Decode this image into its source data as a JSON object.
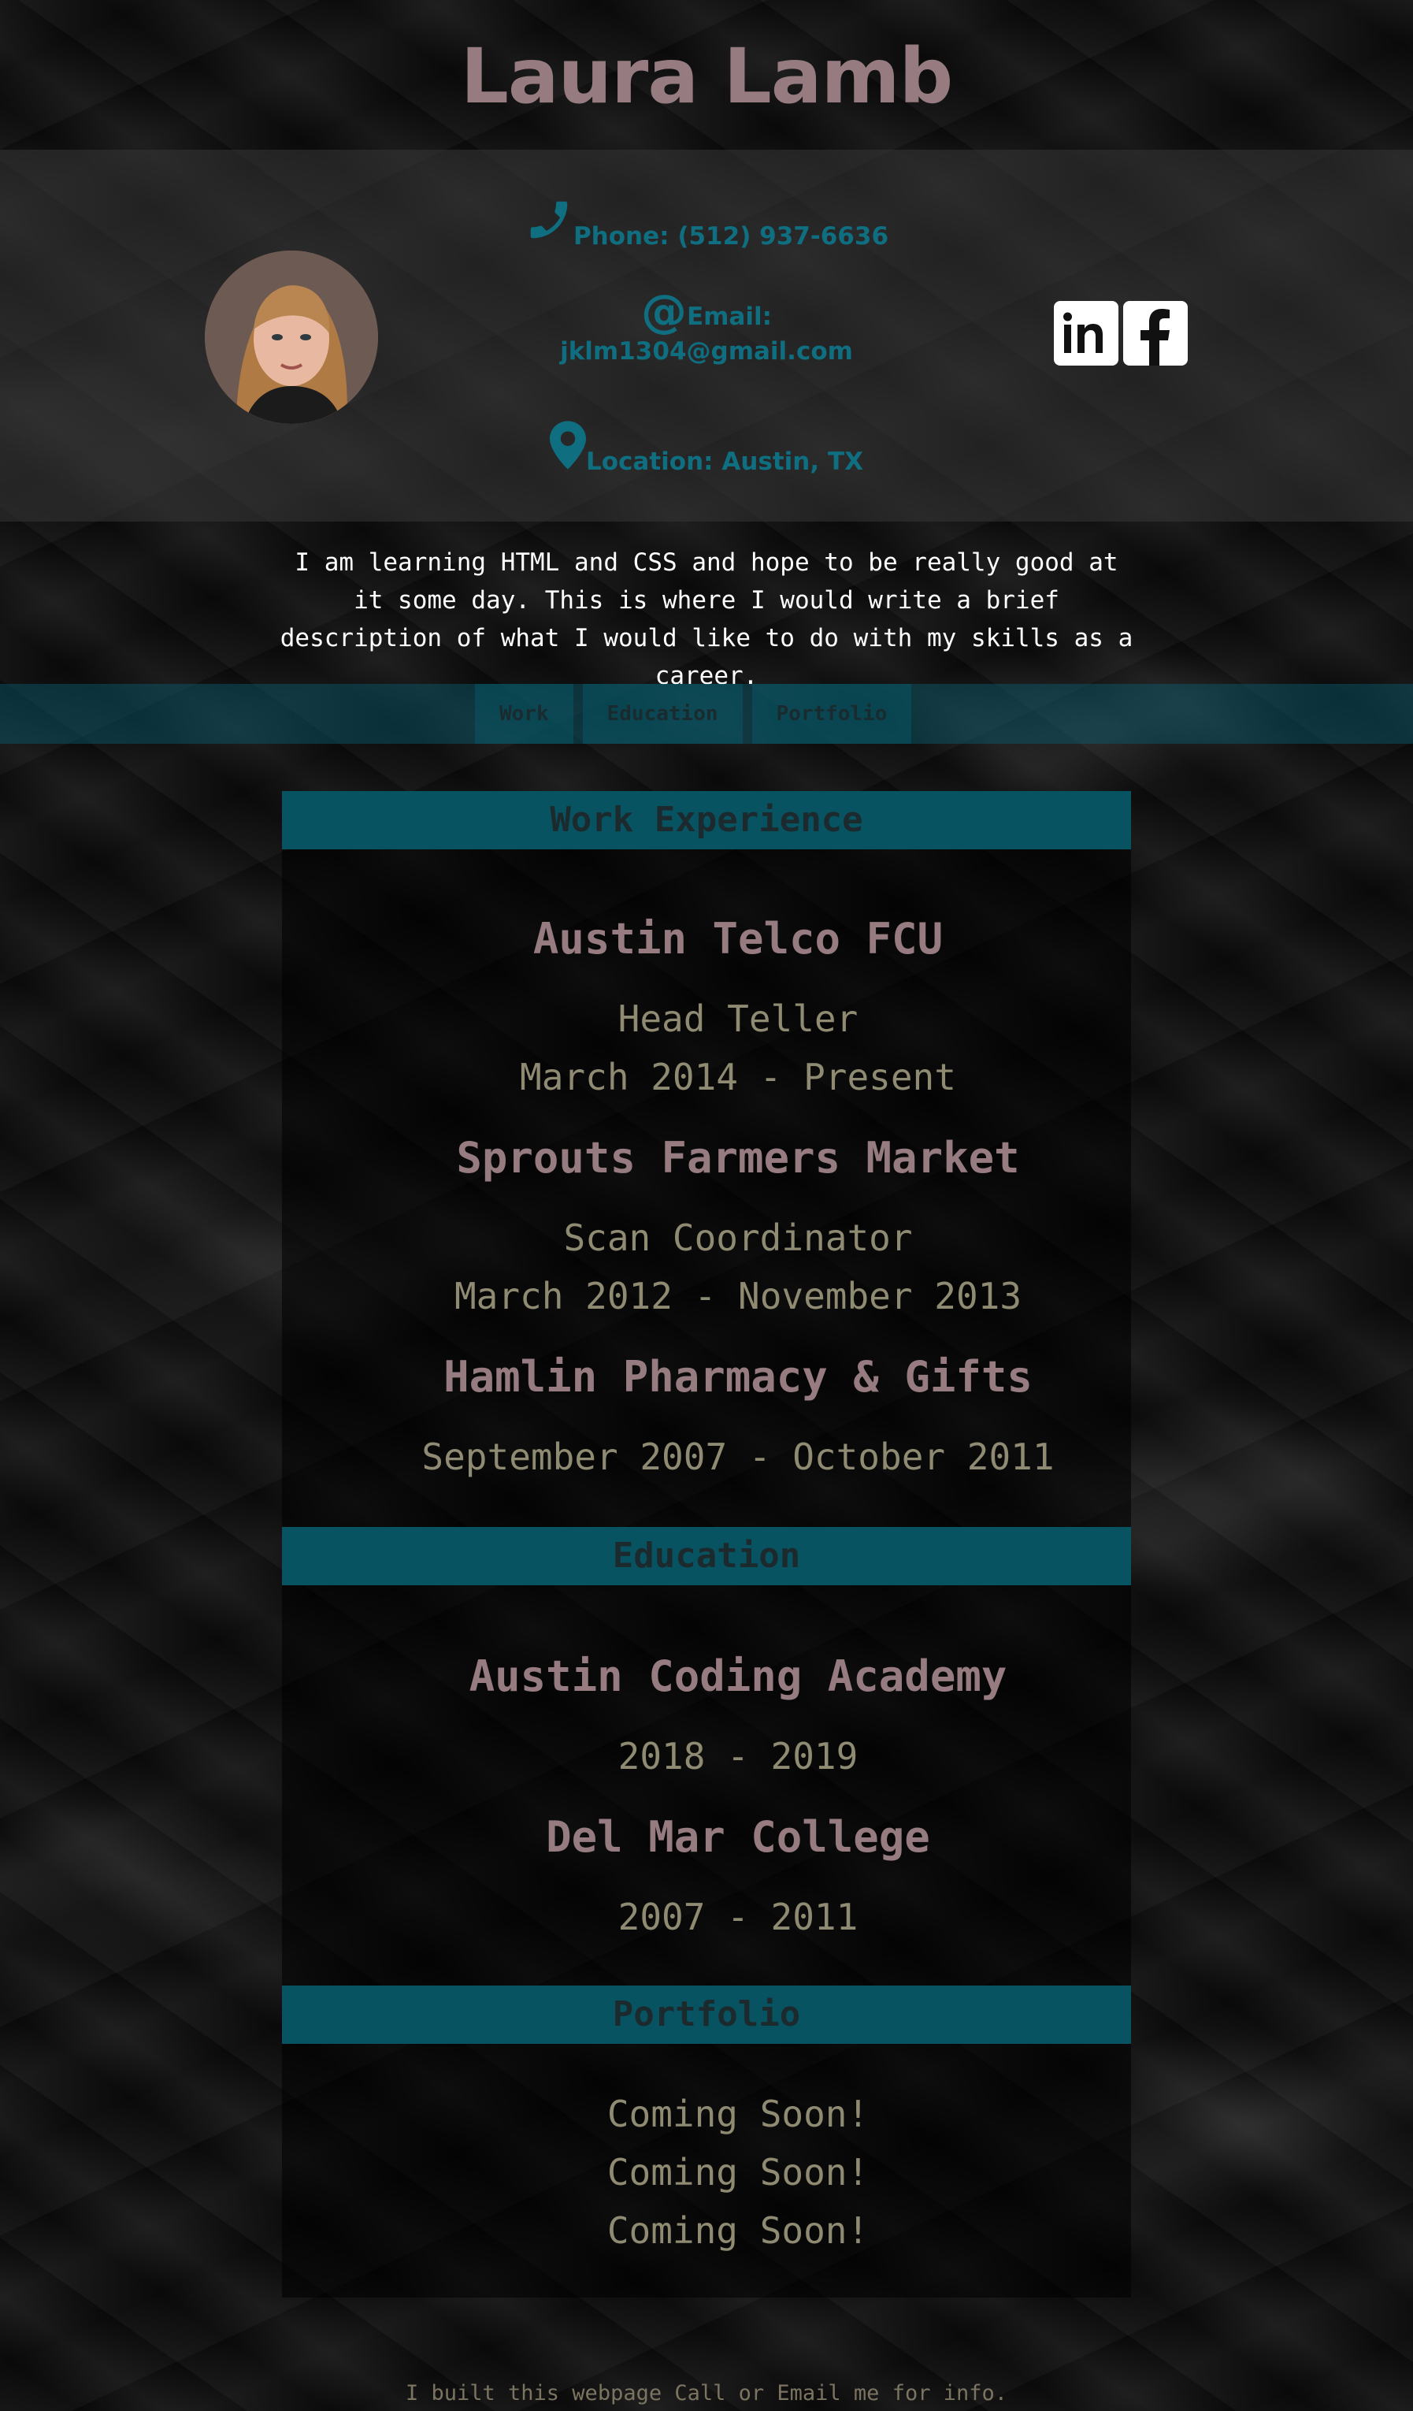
{
  "header": {
    "name": "Laura Lamb"
  },
  "contact": {
    "phone": "Phone: (512) 937-6636",
    "email_label": "Email:",
    "email_value": "jklm1304@gmail.com",
    "location": "Location: Austin, TX",
    "social": [
      "linkedin",
      "facebook"
    ]
  },
  "intro": {
    "text": "I am learning HTML and CSS and hope to be really good at it some day. This is where I would write a brief description of what I would like to do with my skills as a career."
  },
  "nav": {
    "items": [
      "Work",
      "Education",
      "Portfolio"
    ]
  },
  "work": {
    "title": "Work Experience",
    "jobs": [
      {
        "company": "Austin Telco FCU",
        "position": "Head Teller",
        "dates": "March 2014 - Present"
      },
      {
        "company": "Sprouts Farmers Market",
        "position": "Scan Coordinator",
        "dates": "March 2012 - November 2013"
      },
      {
        "company": "Hamlin Pharmacy & Gifts",
        "dates": "September 2007 - October 2011"
      }
    ]
  },
  "education": {
    "title": "Education",
    "schools": [
      {
        "name": "Austin Coding Academy",
        "dates": "2018 - 2019"
      },
      {
        "name": "Del Mar College",
        "dates": "2007 - 2011"
      }
    ]
  },
  "portfolio": {
    "title": "Portfolio",
    "items": [
      "Coming Soon!",
      "Coming Soon!",
      "Coming Soon!"
    ]
  },
  "footer": {
    "text": "I built this webpage Call or Email me for info."
  },
  "colors": {
    "name": "#967c80",
    "accent_teal": "#0f6e80",
    "section_header": "#075361",
    "detail_text": "#8f8a72"
  }
}
